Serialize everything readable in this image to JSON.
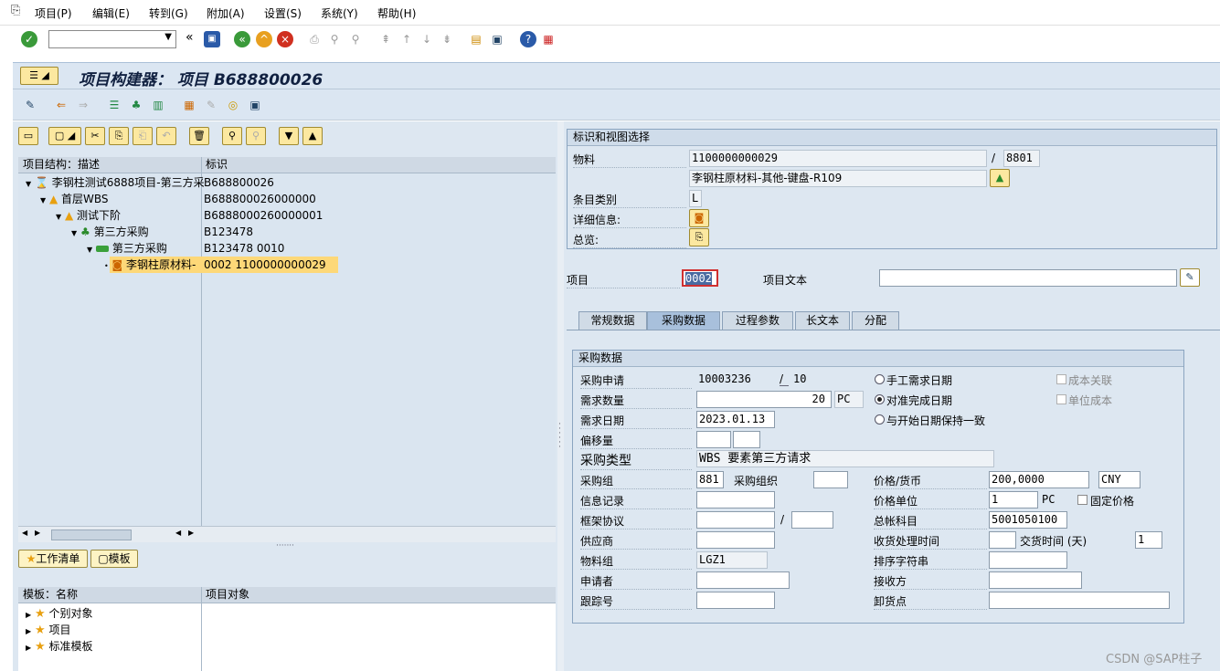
{
  "menubar": {
    "items": [
      "项目(P)",
      "编辑(E)",
      "转到(G)",
      "附加(A)",
      "设置(S)",
      "系统(Y)",
      "帮助(H)"
    ]
  },
  "title": "项目构建器： 项目 B688800026",
  "left": {
    "tree_header": {
      "col1": "项目结构：描述",
      "col2": "标识"
    },
    "tree": [
      {
        "label": "李钢柱测试6888项目-第三方采",
        "id": "B688800026",
        "icon": "project-icon"
      },
      {
        "label": "首层WBS",
        "id": "B688800026000000",
        "icon": "wbs-icon"
      },
      {
        "label": "测试下阶",
        "id": "B6888000260000001",
        "icon": "wbs-icon"
      },
      {
        "label": "第三方采购",
        "id": "B123478",
        "icon": "network-icon"
      },
      {
        "label": "第三方采购",
        "id": "B123478 0010",
        "icon": "activity-icon"
      },
      {
        "label": "李钢柱原材料-",
        "id": "0002 1100000000029",
        "icon": "component-icon"
      }
    ],
    "worklist_btn": "工作清单",
    "template_btn": "模板",
    "tmpl_header": {
      "col1": "模板：名称",
      "col2": "项目对象"
    },
    "templates": [
      "个别对象",
      "项目",
      "标准模板"
    ]
  },
  "right": {
    "ident_title": "标识和视图选择",
    "material_label": "物料",
    "material_value": "1100000000029",
    "slash": "/",
    "plant_value": "8801",
    "material_desc": "李钢柱原材料-其他-键盘-R109",
    "item_cat_label": "条目类别",
    "item_cat_value": "L",
    "detail_label": "详细信息:",
    "overview_label": "总览:",
    "item_label": "项目",
    "item_value": "0002",
    "item_text_label": "项目文本",
    "item_text_value": "",
    "tabs": [
      "常规数据",
      "采购数据",
      "过程参数",
      "长文本",
      "分配"
    ],
    "active_tab": "采购数据",
    "purch": {
      "title": "采购数据",
      "pr_label": "采购申请",
      "pr_value": "10003236",
      "pr_slash": "/",
      "pr_item": "10",
      "qty_label": "需求数量",
      "qty_value": "20",
      "qty_unit": "PC",
      "date_label": "需求日期",
      "date_value": "2023.01.13",
      "offset_label": "偏移量",
      "ptype_label": "采购类型",
      "ptype_value": "WBS 要素第三方请求",
      "pgroup_label": "采购组",
      "pgroup_value": "881",
      "porg_label": "采购组织",
      "porg_value": "",
      "info_label": "信息记录",
      "outline_label": "框架协议",
      "outline_slash": "/",
      "vendor_label": "供应商",
      "matgroup_label": "物料组",
      "matgroup_value": "LGZ1",
      "requester_label": "申请者",
      "tracking_label": "跟踪号",
      "radio1": "手工需求日期",
      "radio2": "对准完成日期",
      "radio3": "与开始日期保持一致",
      "radio_selected": "对准完成日期",
      "chk1": "成本关联",
      "chk2": "单位成本",
      "price_label": "价格/货币",
      "price_value": "200,0000",
      "currency_value": "CNY",
      "priceunit_label": "价格单位",
      "priceunit_value": "1",
      "priceunit_unit": "PC",
      "fixed_price_label": "固定价格",
      "gl_label": "总帐科目",
      "gl_value": "5001050100",
      "gr_label": "收货处理时间",
      "gr_value": "",
      "dt_label": "交货时间 (天)",
      "dt_value": "1",
      "sort_label": "排序字符串",
      "recipient_label": "接收方",
      "unload_label": "卸货点"
    }
  },
  "watermark": "CSDN @SAP柱子"
}
